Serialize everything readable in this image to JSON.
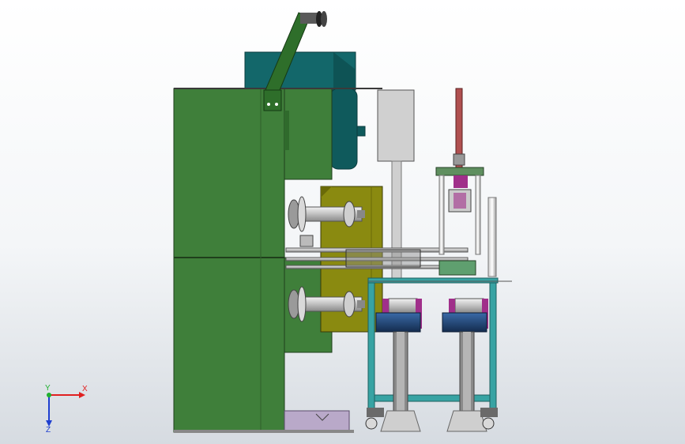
{
  "viewport": {
    "background_top": "#ffffff",
    "background_bottom": "#d6dbe1"
  },
  "triad": {
    "x_label": "X",
    "y_label": "Y",
    "z_label": "Z",
    "x_color": "#e02020",
    "y_color": "#20b030",
    "z_color": "#1f3fd0"
  },
  "colors": {
    "frame_green": "#3f7f3a",
    "motor_teal": "#13676a",
    "plate_olive": "#8a8a10",
    "grey_box": "#d0d0d0",
    "frame_teal": "#37a3a3",
    "motor_navy": "#1f3f6a",
    "magenta": "#a02f8a",
    "base_lilac": "#b9a9c9",
    "rod_red": "#b05050"
  }
}
